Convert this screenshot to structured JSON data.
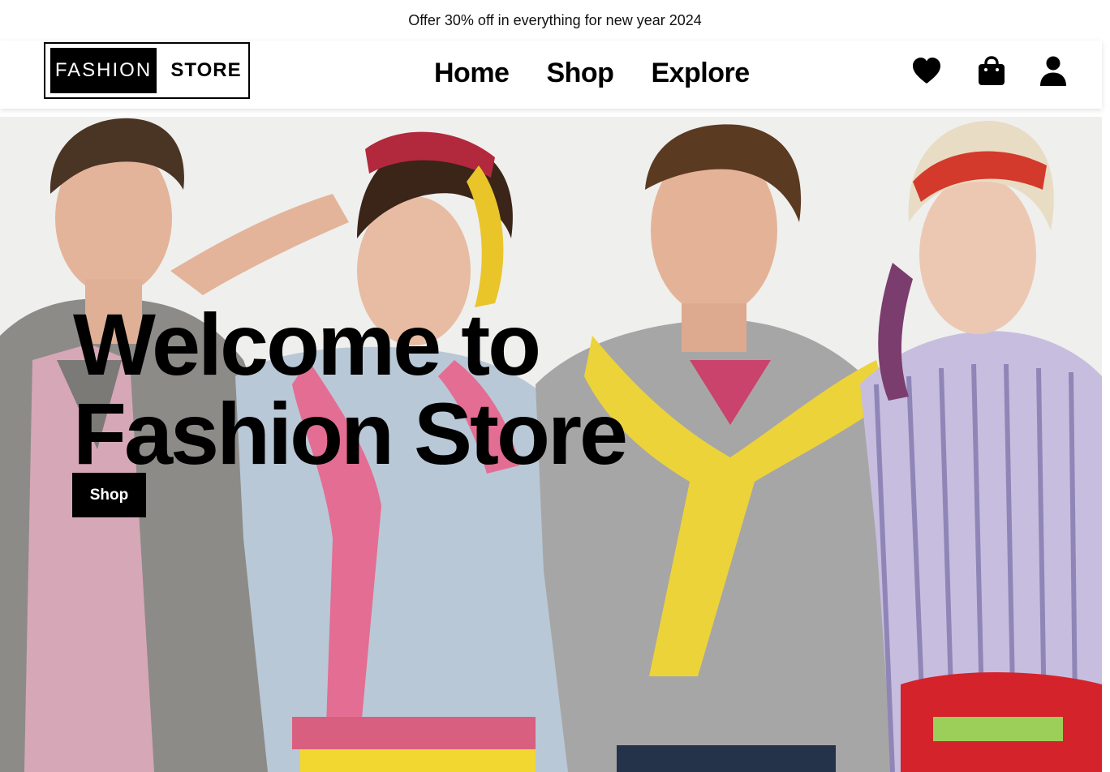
{
  "promo": {
    "text": "Offer 30% off in everything for new year 2024"
  },
  "logo": {
    "left_text": "FASHION",
    "right_text": "STORE"
  },
  "nav": {
    "items": [
      {
        "label": "Home"
      },
      {
        "label": "Shop"
      },
      {
        "label": "Explore"
      }
    ]
  },
  "header_icons": {
    "wishlist": "heart-icon",
    "cart": "shopping-bag-icon",
    "account": "user-icon"
  },
  "hero": {
    "title_line1": "Welcome to",
    "title_line2": "Fashion Store",
    "button_label": "Shop",
    "image_alt": "hero-models-photo"
  },
  "colors": {
    "text": "#000000",
    "button_bg": "#000000",
    "button_text": "#ffffff",
    "header_bg": "#ffffff",
    "hero_bg": "#eeeeec"
  }
}
